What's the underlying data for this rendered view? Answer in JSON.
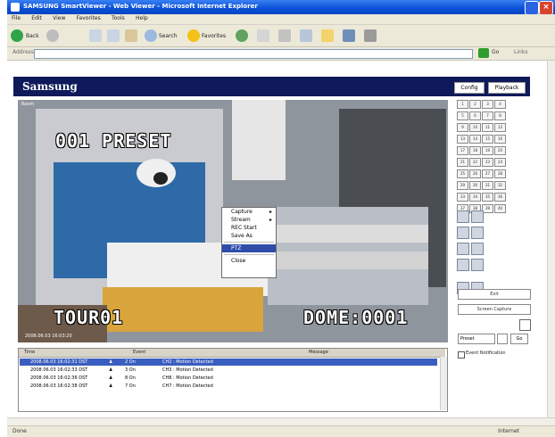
{
  "window": {
    "title": "SAMSUNG SmartViewer - Web Viewer - Microsoft Internet Explorer"
  },
  "menubar": [
    "File",
    "Edit",
    "View",
    "Favorites",
    "Tools",
    "Help"
  ],
  "toolbar": {
    "back": "Back",
    "search": "Search",
    "favorites": "Favorites"
  },
  "address": {
    "label": "Address",
    "go": "Go",
    "links": "Links"
  },
  "app": {
    "logo": "Samsung",
    "config_button": "Config",
    "playback_button": "Playback"
  },
  "video": {
    "cam_label": "Room",
    "osd_top": "001 PRESET",
    "osd_bottom_left": "TOUR01",
    "osd_bottom_right": "DOME:0001",
    "timestamp": "2008.06.03 16:03:20"
  },
  "context_menu": {
    "items": [
      "Capture",
      "Stream",
      "REC Start",
      "Save As",
      "PTZ",
      "Close"
    ]
  },
  "channels": [
    "1",
    "2",
    "3",
    "4",
    "5",
    "6",
    "7",
    "8",
    "9",
    "10",
    "11",
    "12",
    "13",
    "14",
    "15",
    "16",
    "17",
    "18",
    "19",
    "20",
    "21",
    "22",
    "23",
    "24",
    "25",
    "26",
    "27",
    "28",
    "29",
    "30",
    "31",
    "32",
    "33",
    "34",
    "35",
    "36",
    "37",
    "38",
    "39",
    "40"
  ],
  "right_panel": {
    "btn1": "Exit",
    "btn2": "Screen Capture",
    "select_label": "Preset",
    "go_label": "Go",
    "checkbox_label": "Event Notification"
  },
  "events": {
    "headers": [
      "Time",
      "Event",
      "Message"
    ],
    "rows": [
      {
        "time": "2008.06.03 16:02:31 DST",
        "event": "2 On",
        "message": "CH2 : Motion Detected"
      },
      {
        "time": "2008.06.03 16:02:33 DST",
        "event": "3 On",
        "message": "CH3 : Motion Detected"
      },
      {
        "time": "2008.06.03 16:02:36 DST",
        "event": "8 On",
        "message": "CH8 : Motion Detected"
      },
      {
        "time": "2008.06.03 16:02:38 DST",
        "event": "7 On",
        "message": "CH7 : Motion Detected"
      }
    ]
  },
  "statusbar": {
    "left": "Done",
    "right": "Internet"
  },
  "colors": {
    "header_navy": "#0e1a5a",
    "title_blue": "#0a4fd6",
    "selection_blue": "#2f4da8"
  }
}
